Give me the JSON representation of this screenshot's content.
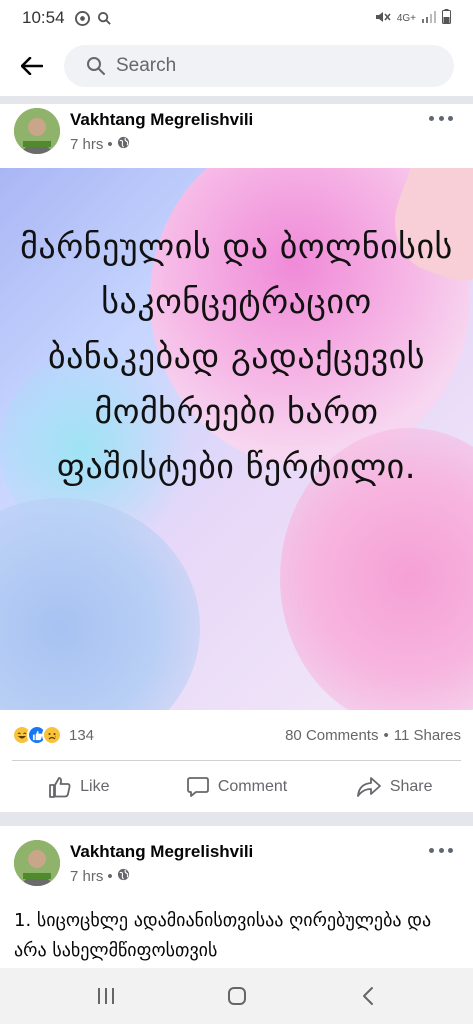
{
  "status_bar": {
    "time": "10:54",
    "network": "4G+",
    "icons": [
      "chrome-icon",
      "search-icon",
      "mute-icon",
      "signal-icon",
      "battery-icon"
    ]
  },
  "search": {
    "placeholder": "Search"
  },
  "posts": [
    {
      "author": "Vakhtang Megrelishvili",
      "time": "7 hrs",
      "visibility": "public",
      "image_text": "მარნეულის და ბოლნისის საკონცეტრაციო ბანაკებად გადაქცევის მომხრეები ხართ ფაშისტები წერტილი.",
      "reactions": {
        "icons": [
          "haha",
          "like",
          "sad"
        ],
        "count": "134",
        "comments": "80 Comments",
        "shares": "11 Shares",
        "separator": "•"
      }
    },
    {
      "author": "Vakhtang Megrelishvili",
      "time": "7 hrs",
      "visibility": "public",
      "text": "1. სიცოცხლე ადამიანისთვისაა ღირებულება და არა სახელმწიფოსთვის"
    }
  ],
  "actions": {
    "like": "Like",
    "comment": "Comment",
    "share": "Share"
  },
  "meta_separator": "•",
  "colors": {
    "facebook_gray": "#65676b",
    "divider": "#e4e6eb",
    "like_blue": "#1877f2",
    "haha_yellow": "#f7c33b"
  }
}
